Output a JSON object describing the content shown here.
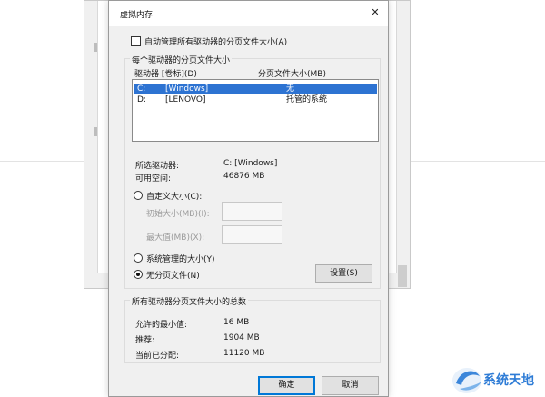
{
  "dialog": {
    "title": "虚拟内存",
    "close_glyph": "✕",
    "auto_manage_label": "自动管理所有驱动器的分页文件大小(A)"
  },
  "per_drive": {
    "group_title": "每个驱动器的分页文件大小",
    "col_drive": "驱动器 [卷标](D)",
    "col_size": "分页文件大小(MB)",
    "rows": [
      {
        "drive": "C:",
        "label": "[Windows]",
        "size": "无"
      },
      {
        "drive": "D:",
        "label": "[LENOVO]",
        "size": "托管的系统"
      }
    ]
  },
  "selected": {
    "drive_label": "所选驱动器:",
    "drive_value": "C:  [Windows]",
    "space_label": "可用空间:",
    "space_value": "46876 MB"
  },
  "options": {
    "custom_label": "自定义大小(C):",
    "initial_label": "初始大小(MB)(I):",
    "max_label": "最大值(MB)(X):",
    "system_label": "系统管理的大小(Y)",
    "none_label": "无分页文件(N)",
    "set_button": "设置(S)"
  },
  "totals": {
    "group_title": "所有驱动器分页文件大小的总数",
    "min_label": "允许的最小值:",
    "min_value": "16 MB",
    "recommended_label": "推荐:",
    "recommended_value": "1904 MB",
    "current_label": "当前已分配:",
    "current_value": "11120 MB"
  },
  "buttons": {
    "ok": "确定",
    "cancel": "取消"
  },
  "watermark": {
    "text": "系统天地"
  },
  "colors": {
    "selection": "#2d73d2",
    "accent": "#0078d7",
    "dialog_bg": "#f0f0f0"
  }
}
